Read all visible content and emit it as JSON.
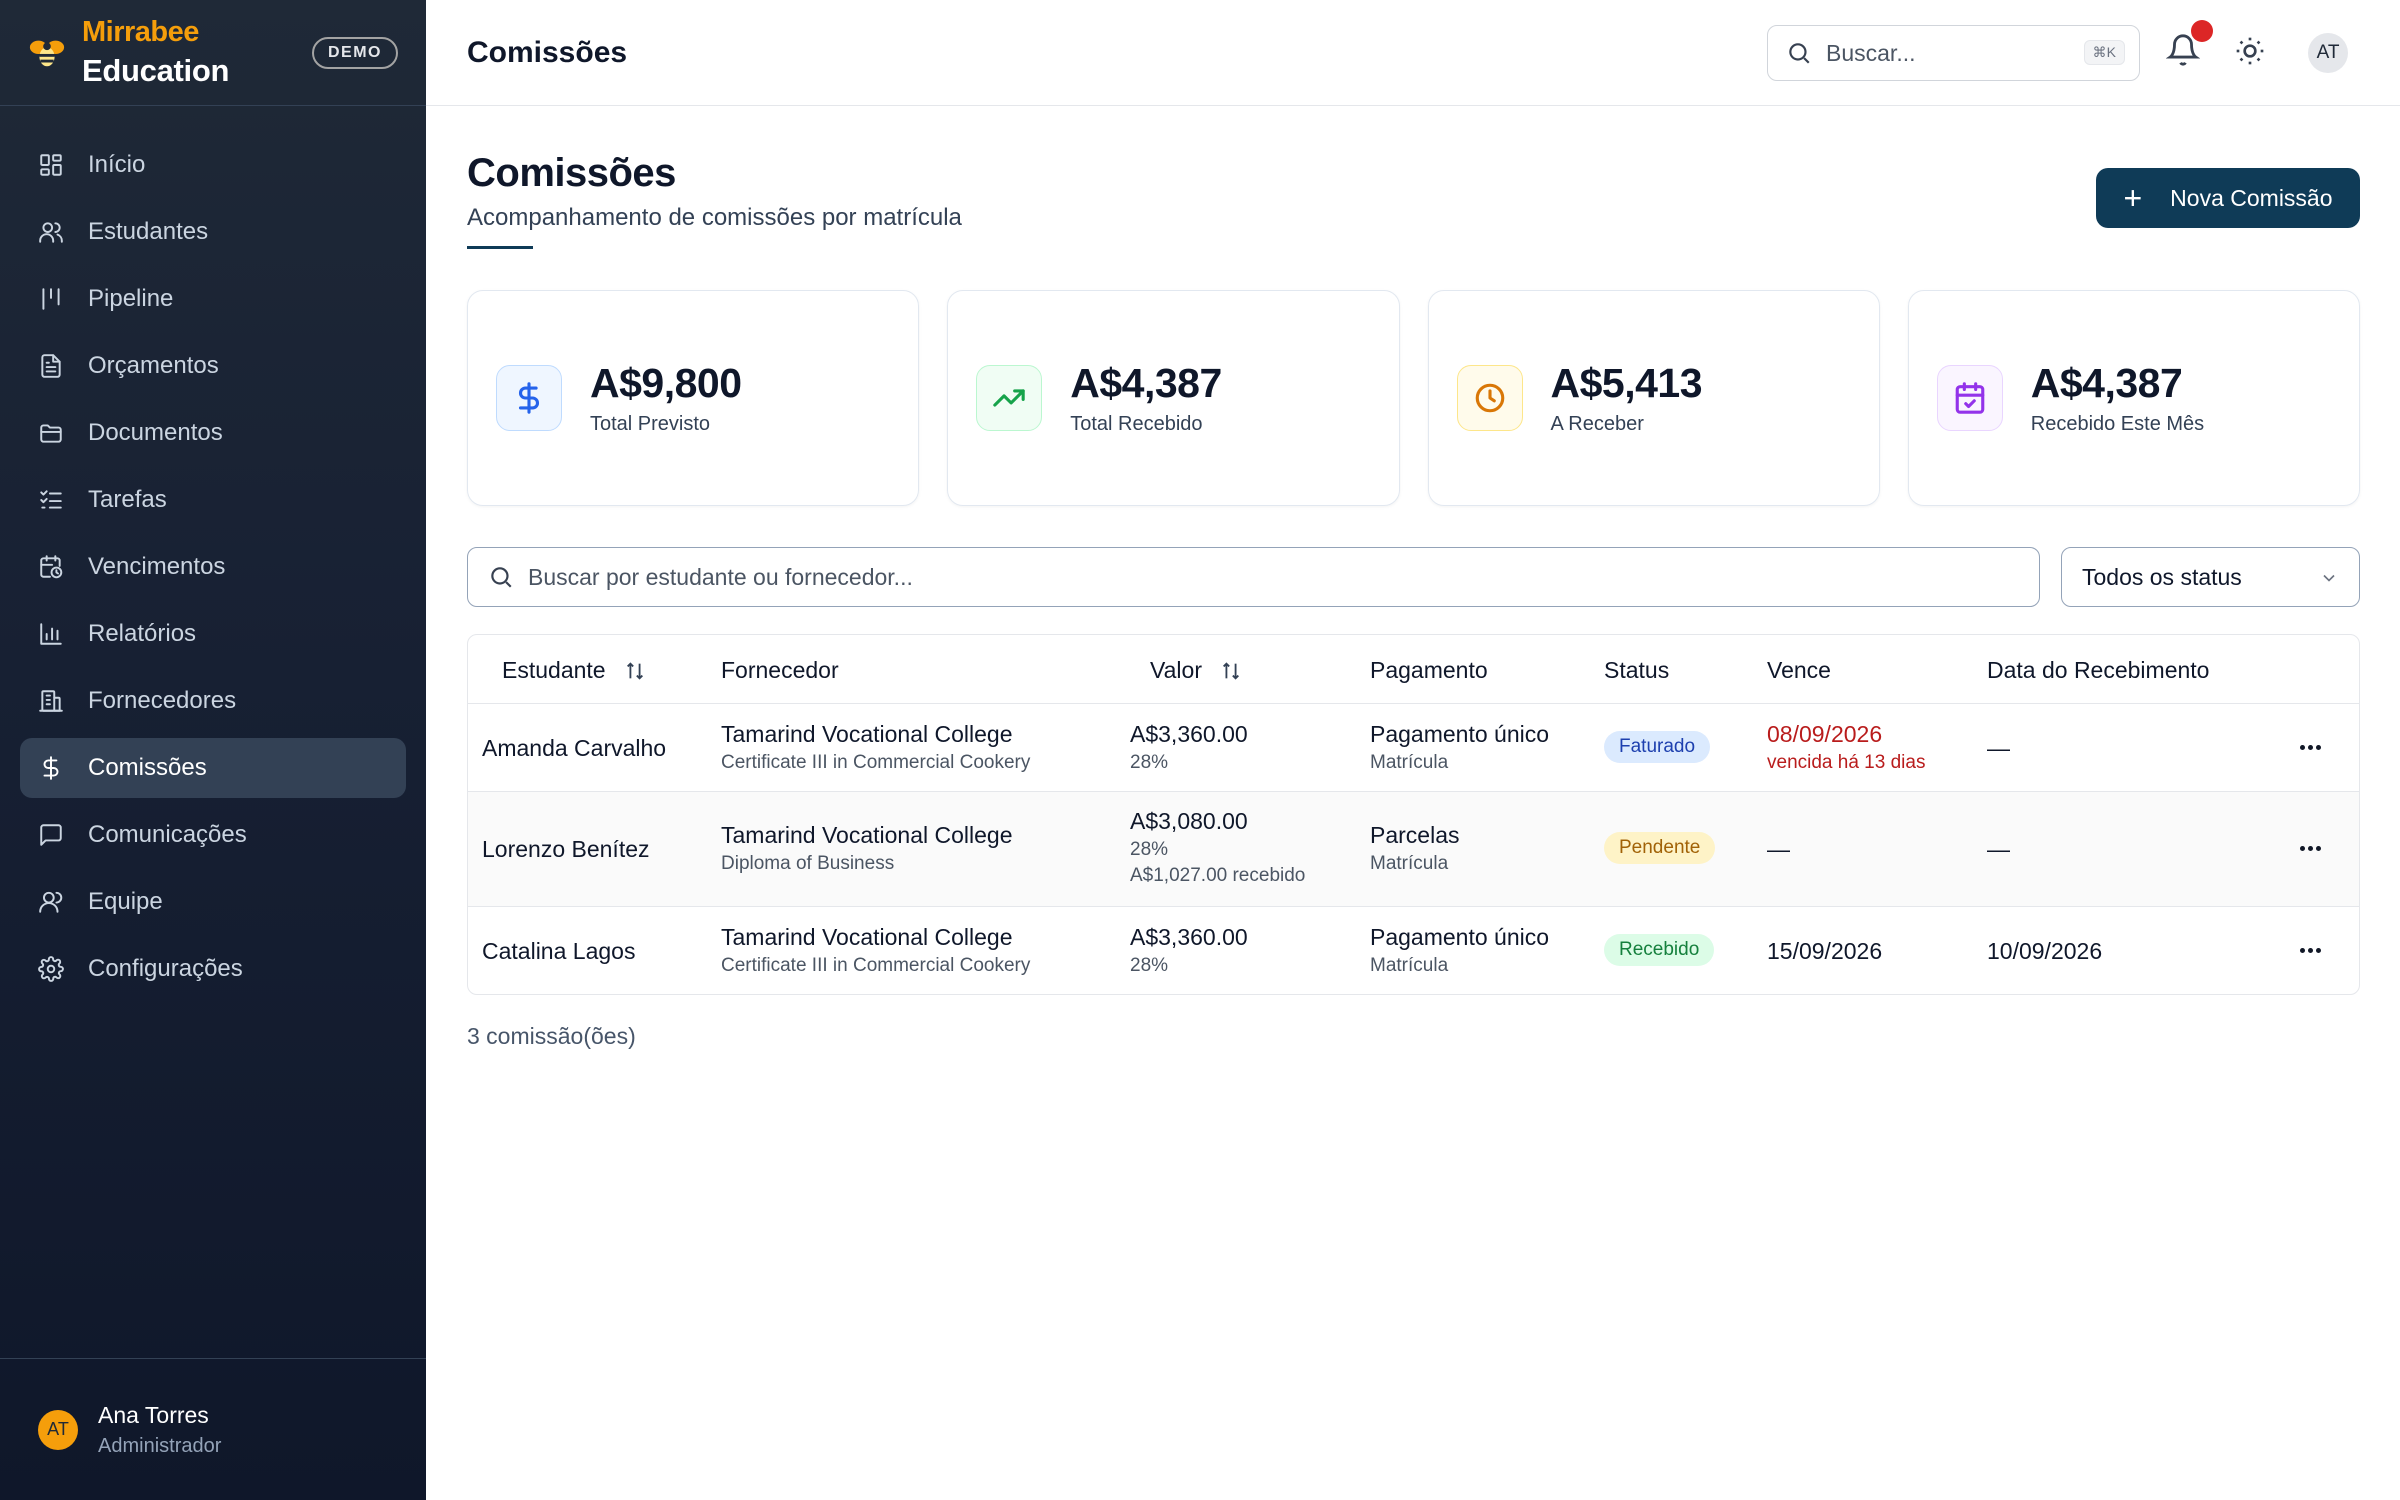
{
  "brand": {
    "name": "Mirrabee",
    "sub": "Education",
    "badge": "DEMO"
  },
  "nav": [
    {
      "label": "Início",
      "icon": "grid-icon"
    },
    {
      "label": "Estudantes",
      "icon": "users-icon"
    },
    {
      "label": "Pipeline",
      "icon": "pipeline-icon"
    },
    {
      "label": "Orçamentos",
      "icon": "file-text-icon"
    },
    {
      "label": "Documentos",
      "icon": "folder-icon"
    },
    {
      "label": "Tarefas",
      "icon": "list-checks-icon"
    },
    {
      "label": "Vencimentos",
      "icon": "calendar-clock-icon"
    },
    {
      "label": "Relatórios",
      "icon": "bar-chart-icon"
    },
    {
      "label": "Fornecedores",
      "icon": "building-icon"
    },
    {
      "label": "Comissões",
      "icon": "dollar-icon",
      "active": true
    },
    {
      "label": "Comunicações",
      "icon": "message-icon"
    },
    {
      "label": "Equipe",
      "icon": "user-icon"
    },
    {
      "label": "Configurações",
      "icon": "gear-icon"
    }
  ],
  "user": {
    "initials": "AT",
    "name": "Ana Torres",
    "role": "Administrador"
  },
  "topbar": {
    "title": "Comissões",
    "search_placeholder": "Buscar...",
    "shortcut": "⌘K",
    "avatar": "AT"
  },
  "page": {
    "title": "Comissões",
    "subtitle": "Acompanhamento de comissões por matrícula",
    "new_button": "Nova Comissão"
  },
  "stats": [
    {
      "value": "A$9,800",
      "label": "Total Previsto",
      "icon": "dollar-icon",
      "color": "#2563eb",
      "bg": "#eff6ff",
      "border": "#bfdbfe"
    },
    {
      "value": "A$4,387",
      "label": "Total Recebido",
      "icon": "trending-up-icon",
      "color": "#16a34a",
      "bg": "#f0fdf4",
      "border": "#bbf7d0"
    },
    {
      "value": "A$5,413",
      "label": "A Receber",
      "icon": "clock-icon",
      "color": "#d97706",
      "bg": "#fffbeb",
      "border": "#fde68a"
    },
    {
      "value": "A$4,387",
      "label": "Recebido Este Mês",
      "icon": "calendar-check-icon",
      "color": "#9333ea",
      "bg": "#faf5ff",
      "border": "#e9d5ff"
    }
  ],
  "filters": {
    "search_placeholder": "Buscar por estudante ou fornecedor...",
    "status_value": "Todos os status"
  },
  "table": {
    "headers": {
      "student": "Estudante",
      "provider": "Fornecedor",
      "value": "Valor",
      "payment": "Pagamento",
      "status": "Status",
      "due": "Vence",
      "received_date": "Data do Recebimento"
    },
    "rows": [
      {
        "student": "Amanda Carvalho",
        "provider": "Tamarind Vocational College",
        "course": "Certificate III in Commercial Cookery",
        "value": "A$3,360.00",
        "rate": "28%",
        "received_note": "",
        "payment": "Pagamento único",
        "payment_type": "Matrícula",
        "status": "Faturado",
        "due": "08/09/2026",
        "due_note": "vencida há 13 dias",
        "received_date": "—"
      },
      {
        "student": "Lorenzo Benítez",
        "provider": "Tamarind Vocational College",
        "course": "Diploma of Business",
        "value": "A$3,080.00",
        "rate": "28%",
        "received_note": "A$1,027.00 recebido",
        "payment": "Parcelas",
        "payment_type": "Matrícula",
        "status": "Pendente",
        "due": "—",
        "due_note": "",
        "received_date": "—"
      },
      {
        "student": "Catalina Lagos",
        "provider": "Tamarind Vocational College",
        "course": "Certificate III in Commercial Cookery",
        "value": "A$3,360.00",
        "rate": "28%",
        "received_note": "",
        "payment": "Pagamento único",
        "payment_type": "Matrícula",
        "status": "Recebido",
        "due": "15/09/2026",
        "due_note": "",
        "received_date": "10/09/2026"
      }
    ]
  },
  "footer_count": "3 comissão(ões)"
}
